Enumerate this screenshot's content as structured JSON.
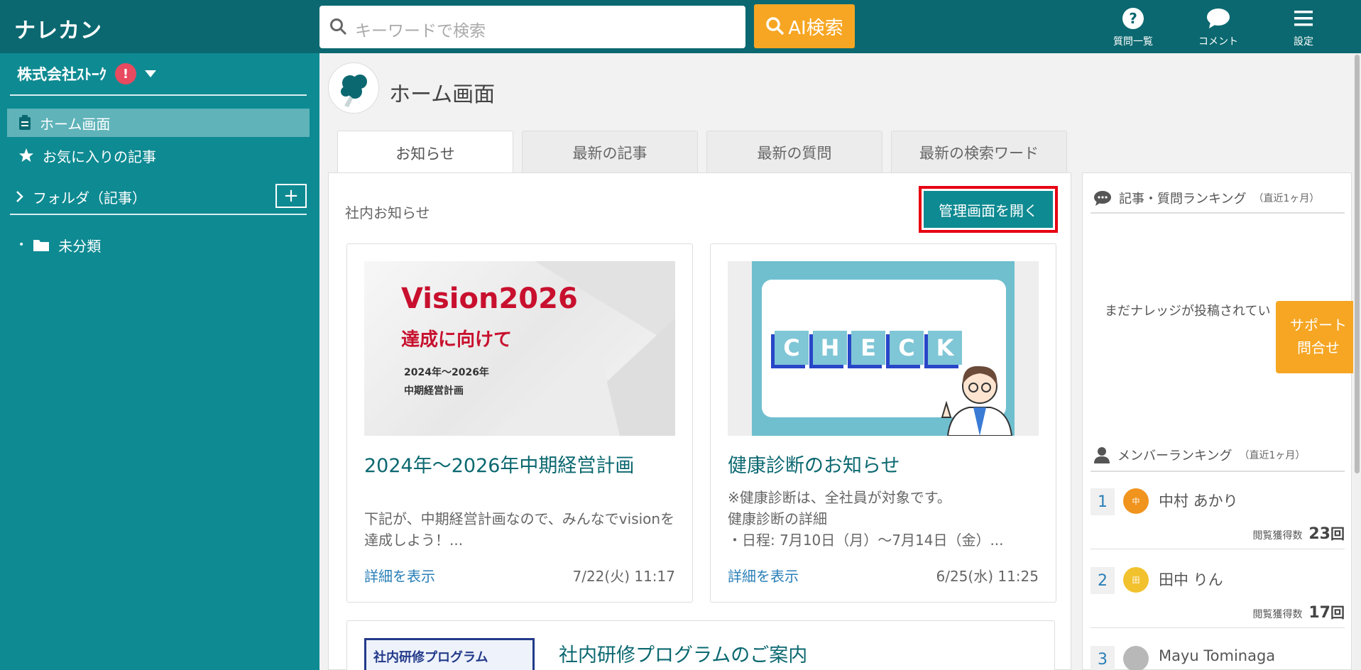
{
  "header": {
    "logo": "ナレカン",
    "search_placeholder": "キーワードで検索",
    "ai_search_label": "AI検索",
    "nav": [
      {
        "label": "質問一覧",
        "icon": "question-icon"
      },
      {
        "label": "コメント",
        "icon": "comment-icon"
      },
      {
        "label": "設定",
        "icon": "menu-icon"
      }
    ]
  },
  "sidebar": {
    "company": "株式会社ｽﾄｰｸ",
    "alert": "!",
    "items": [
      {
        "label": "ホーム画面",
        "icon": "clipboard-icon",
        "active": true
      },
      {
        "label": "お気に入りの記事",
        "icon": "star-icon"
      }
    ],
    "folder_header": "フォルダ（記事）",
    "add_label": "+",
    "folders": [
      {
        "label": "未分類",
        "icon": "folder-icon"
      }
    ]
  },
  "main": {
    "title": "ホーム画面",
    "tabs": [
      "お知らせ",
      "最新の記事",
      "最新の質問",
      "最新の検索ワード"
    ],
    "section_title": "社内お知らせ",
    "admin_button": "管理画面を開く",
    "cards": [
      {
        "thumb_title": "Vision2026",
        "thumb_sub": "達成に向けて",
        "thumb_line1": "2024年～2026年",
        "thumb_line2": "中期経営計画",
        "title": "2024年～2026年中期経営計画",
        "desc": "下記が、中期経営計画なので、みんなでvisionを達成しよう！...",
        "more": "詳細を表示",
        "date": "7/22(火) 11:17"
      },
      {
        "thumb_letters": [
          "C",
          "H",
          "E",
          "C",
          "K"
        ],
        "title": "健康診断のお知らせ",
        "desc": "※健康診断は、全社員が対象です。\n健康診断の詳細\n・日程: 7月10日（月）～7月14日（金）...",
        "more": "詳細を表示",
        "date": "6/25(水) 11:25"
      }
    ],
    "wide_card": {
      "thumb_text": "社内研修プログラム",
      "title": "社内研修プログラムのご案内"
    }
  },
  "right": {
    "ranking1_title": "記事・質問ランキング",
    "ranking1_period": "（直近1ヶ月）",
    "ranking1_empty": "まだナレッジが投稿されてい",
    "ranking2_title": "メンバーランキング",
    "ranking2_period": "（直近1ヶ月）",
    "count_label": "閲覧獲得数",
    "unit": "回",
    "members": [
      {
        "rank": "1",
        "name": "中村 あかり",
        "avatar": "中",
        "avatar_color": "#f0941e",
        "count": "23"
      },
      {
        "rank": "2",
        "name": "田中 りん",
        "avatar": "田",
        "avatar_color": "#f2c12e",
        "count": "17"
      },
      {
        "rank": "3",
        "name": "Mayu Tominaga",
        "avatar": "",
        "avatar_color": "#b8b8b8",
        "count": ""
      }
    ]
  },
  "support": {
    "line1": "サポート",
    "line2": "問合せ"
  },
  "colors": {
    "header": "#0b6870",
    "sidebar": "#0e8a92",
    "accent": "#f6a623",
    "highlight": "#e60012"
  }
}
